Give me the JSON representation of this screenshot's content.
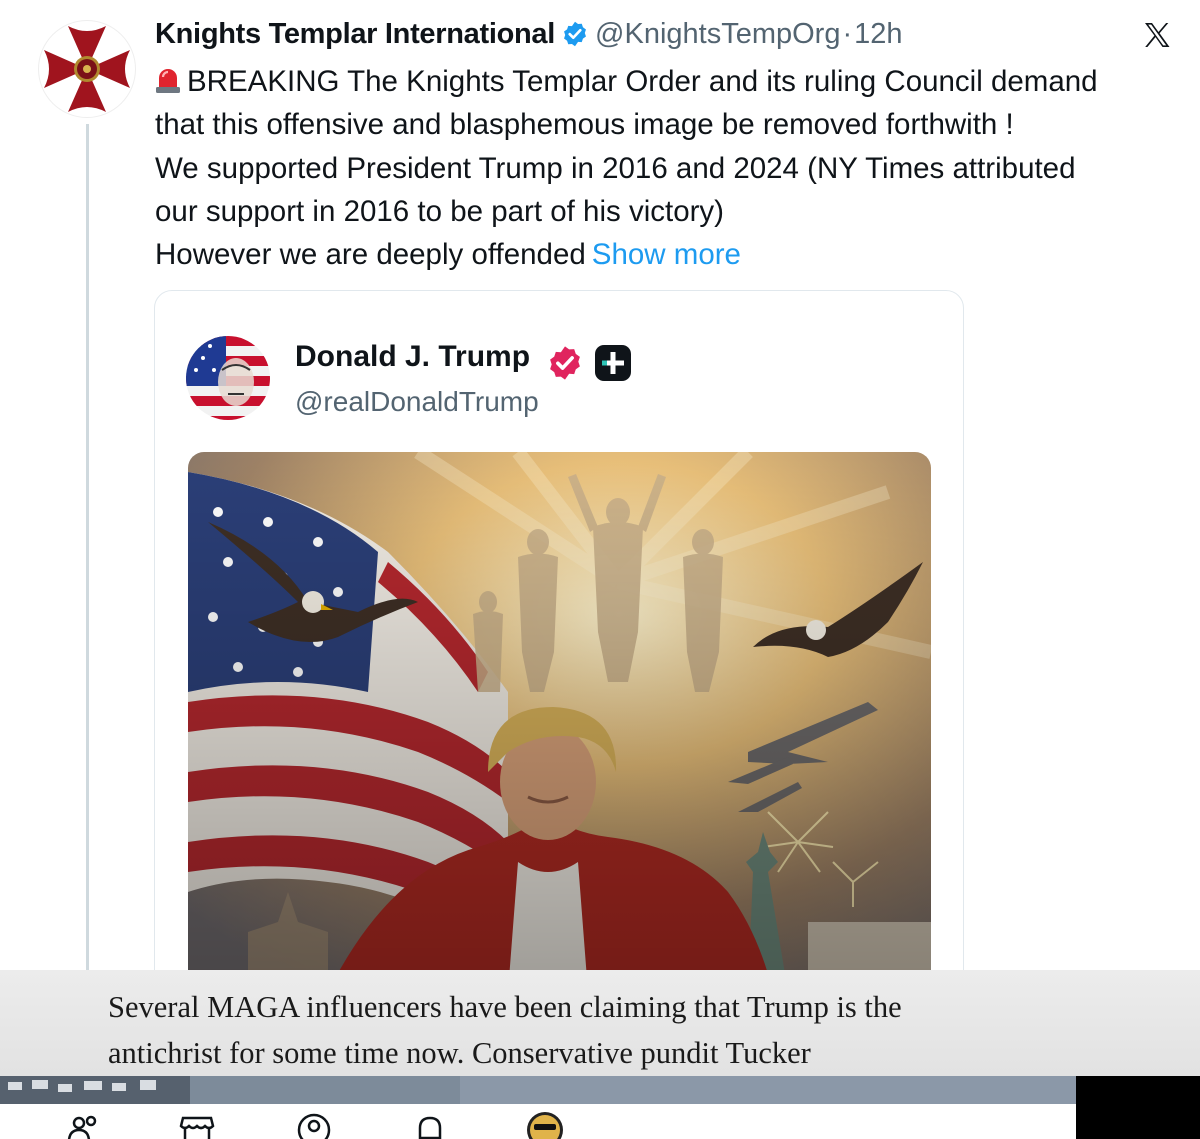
{
  "tweet": {
    "author_name": "Knights Templar International",
    "author_handle": "@KnightsTempOrg",
    "separator": "·",
    "time": "12h",
    "lines": [
      "BREAKING The Knights Templar Order and its ruling Council demand",
      "that this offensive and blasphemous image be removed forthwith !",
      "We supported President Trump in 2016 and 2024 (NY Times attributed",
      "our support in 2016 to be part of his victory)",
      "However we are deeply offended"
    ],
    "show_more": "Show more",
    "icons": [
      "siren-emoji-icon",
      "verified-badge-icon",
      "x-logo-icon"
    ]
  },
  "quote": {
    "author_name": "Donald J. Trump",
    "author_handle": "@realDonaldTrump",
    "icons": [
      "verified-badge-icon",
      "plus-badge-icon"
    ]
  },
  "caption": {
    "lines": [
      "Several MAGA influencers have been claiming that Trump is the",
      "antichrist for some time now. Conservative pundit Tucker"
    ]
  },
  "bottom_nav": {
    "icons": [
      "communities-icon",
      "store-icon",
      "profile-icon",
      "notifications-icon",
      "user-avatar-icon"
    ]
  },
  "colors": {
    "text": "#0f1419",
    "secondary": "#536471",
    "link": "#1d9bf0",
    "verified_blue": "#1d9bf0",
    "verified_pink": "#e0245e",
    "caption_band": "#e6e6e6"
  }
}
